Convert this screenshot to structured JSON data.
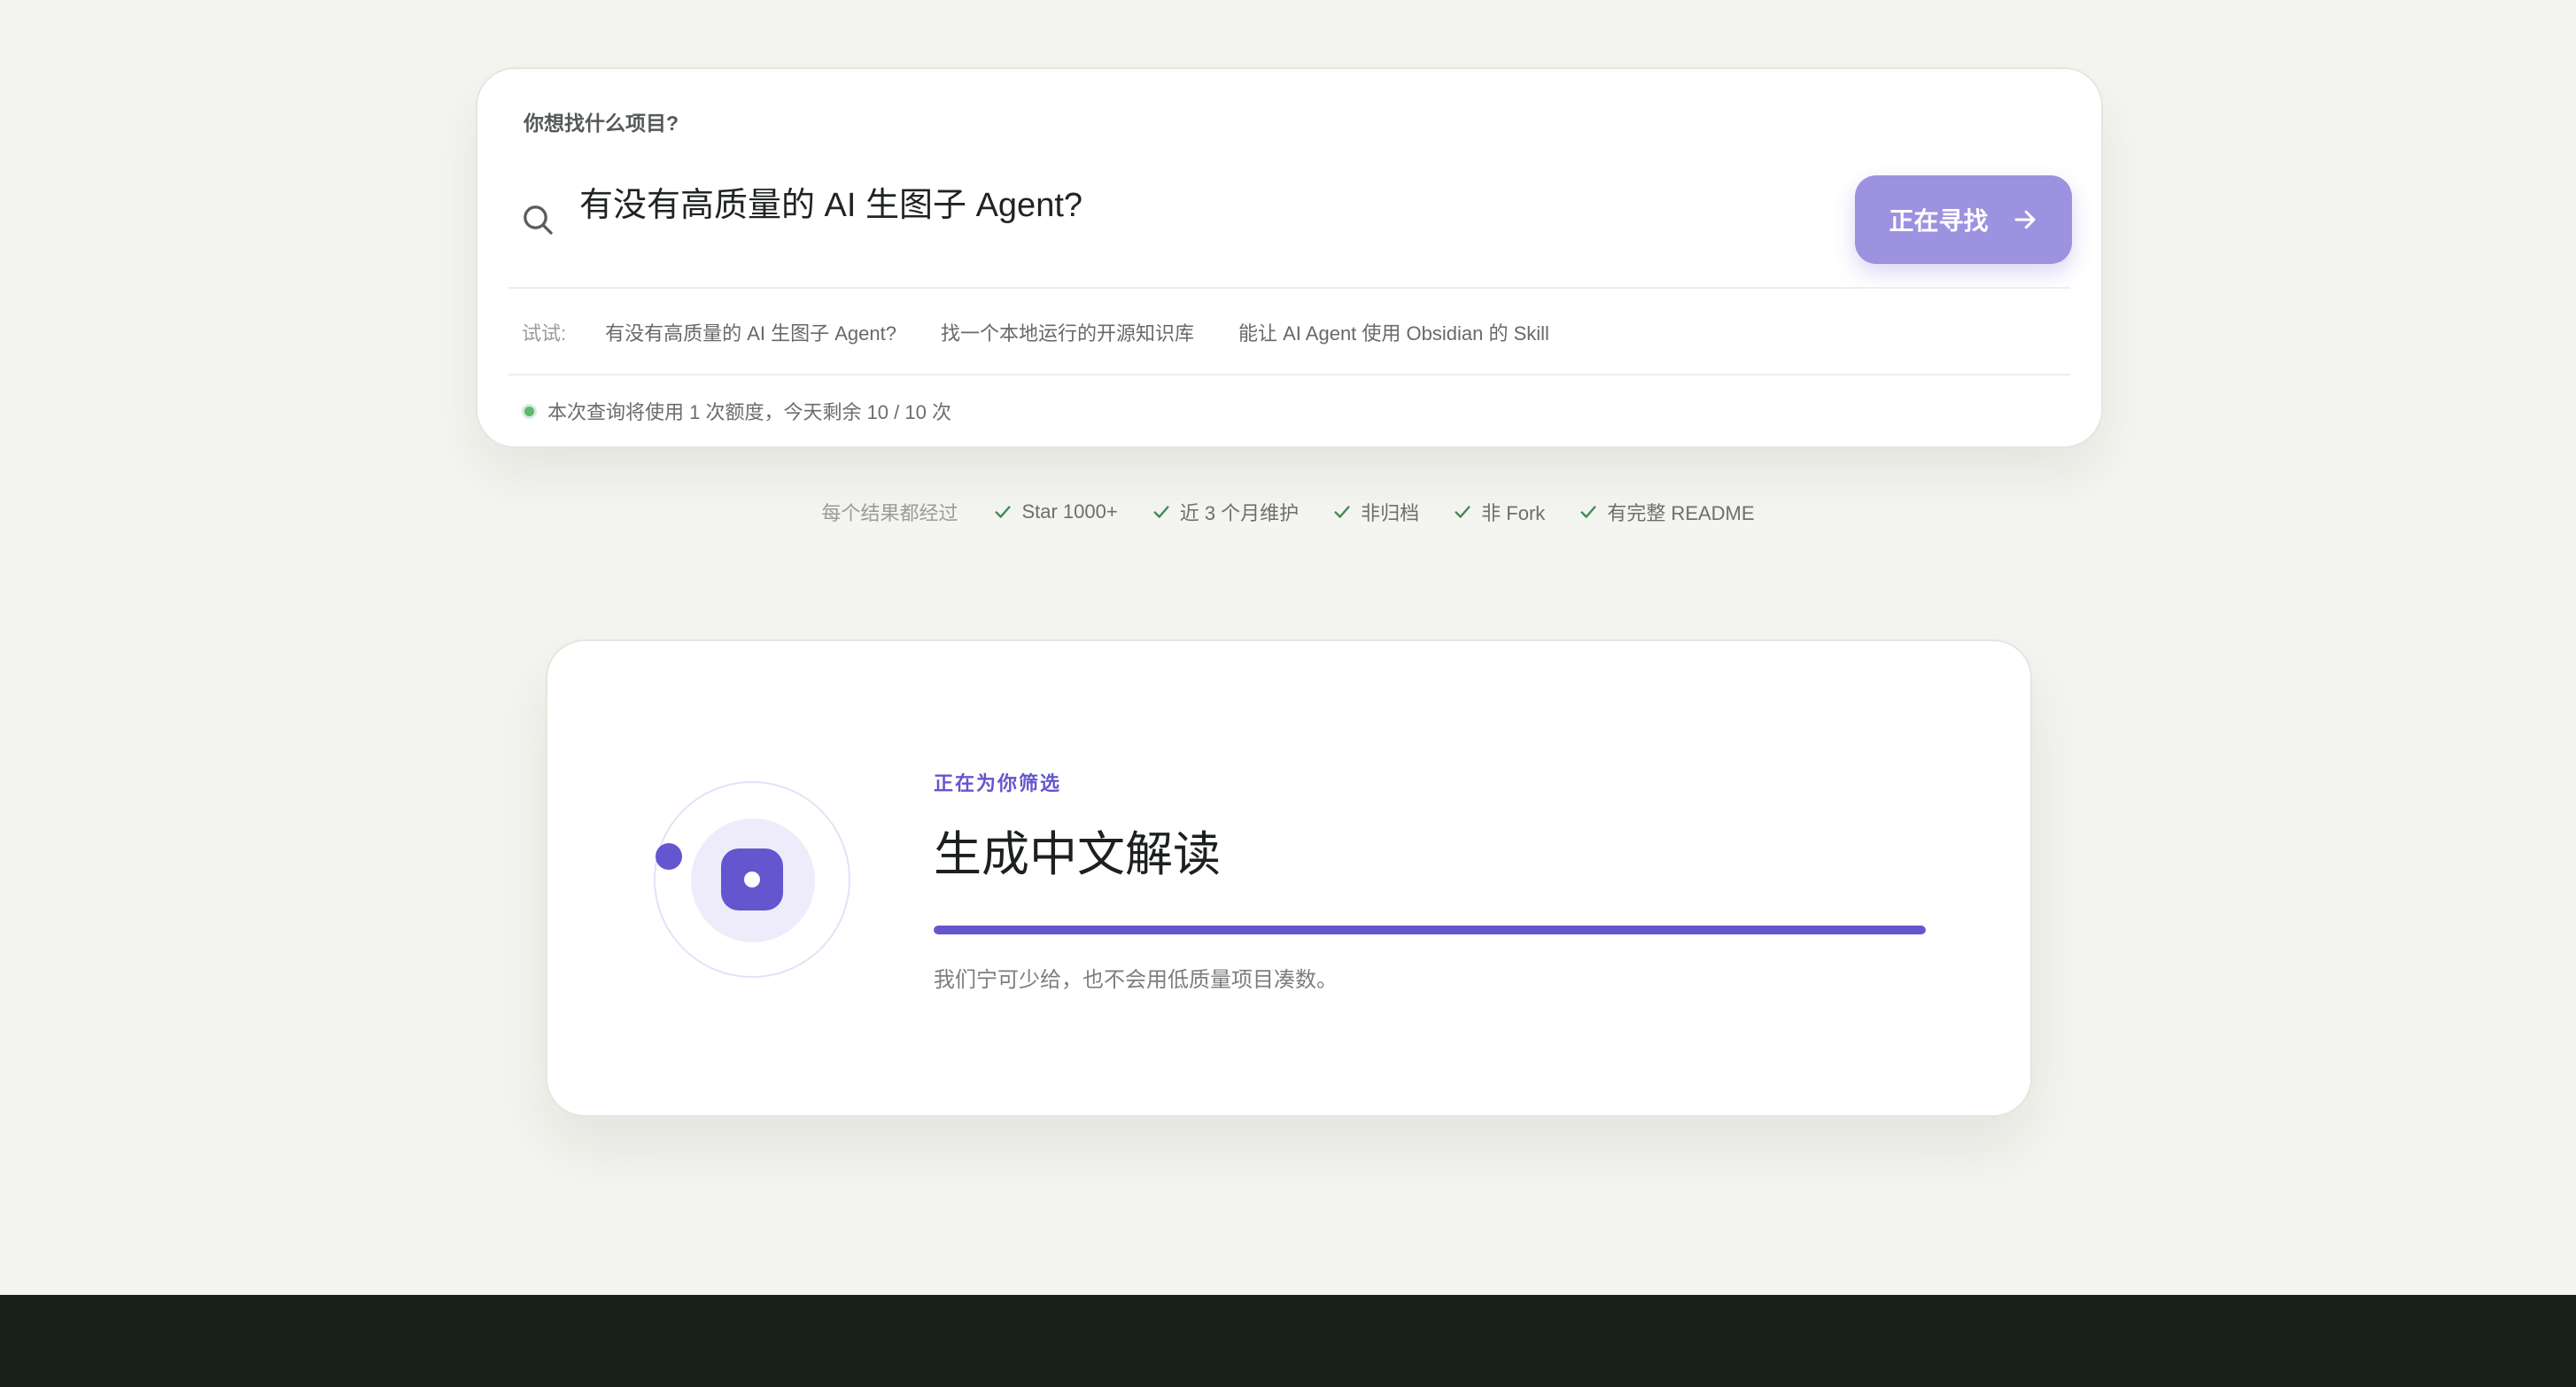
{
  "search": {
    "question_label": "你想找什么项目?",
    "input_value": "有没有高质量的 AI 生图子 Agent?",
    "button_label": "正在寻找",
    "suggestions_prefix": "试试:",
    "suggestions": [
      "有没有高质量的 AI 生图子 Agent?",
      "找一个本地运行的开源知识库",
      "能让 AI Agent 使用 Obsidian 的 Skill"
    ],
    "quota_text": "本次查询将使用 1 次额度，今天剩余 10 / 10 次"
  },
  "criteria": {
    "prefix": "每个结果都经过",
    "items": [
      "Star 1000+",
      "近 3 个月维护",
      "非归档",
      "非 Fork",
      "有完整 README"
    ]
  },
  "progress": {
    "eyebrow": "正在为你筛选",
    "title": "生成中文解读",
    "progress_fraction": 1.0,
    "note": "我们宁可少给，也不会用低质量项目凑数。"
  },
  "colors": {
    "accent": "#6356cf",
    "button_bg": "#9c92df",
    "status_ok": "#5db870",
    "background": "#f4f4f0",
    "footer": "#18201a"
  },
  "icons": {
    "search": "search-icon",
    "button": "arrow-right-icon",
    "criteria": "check-icon"
  }
}
